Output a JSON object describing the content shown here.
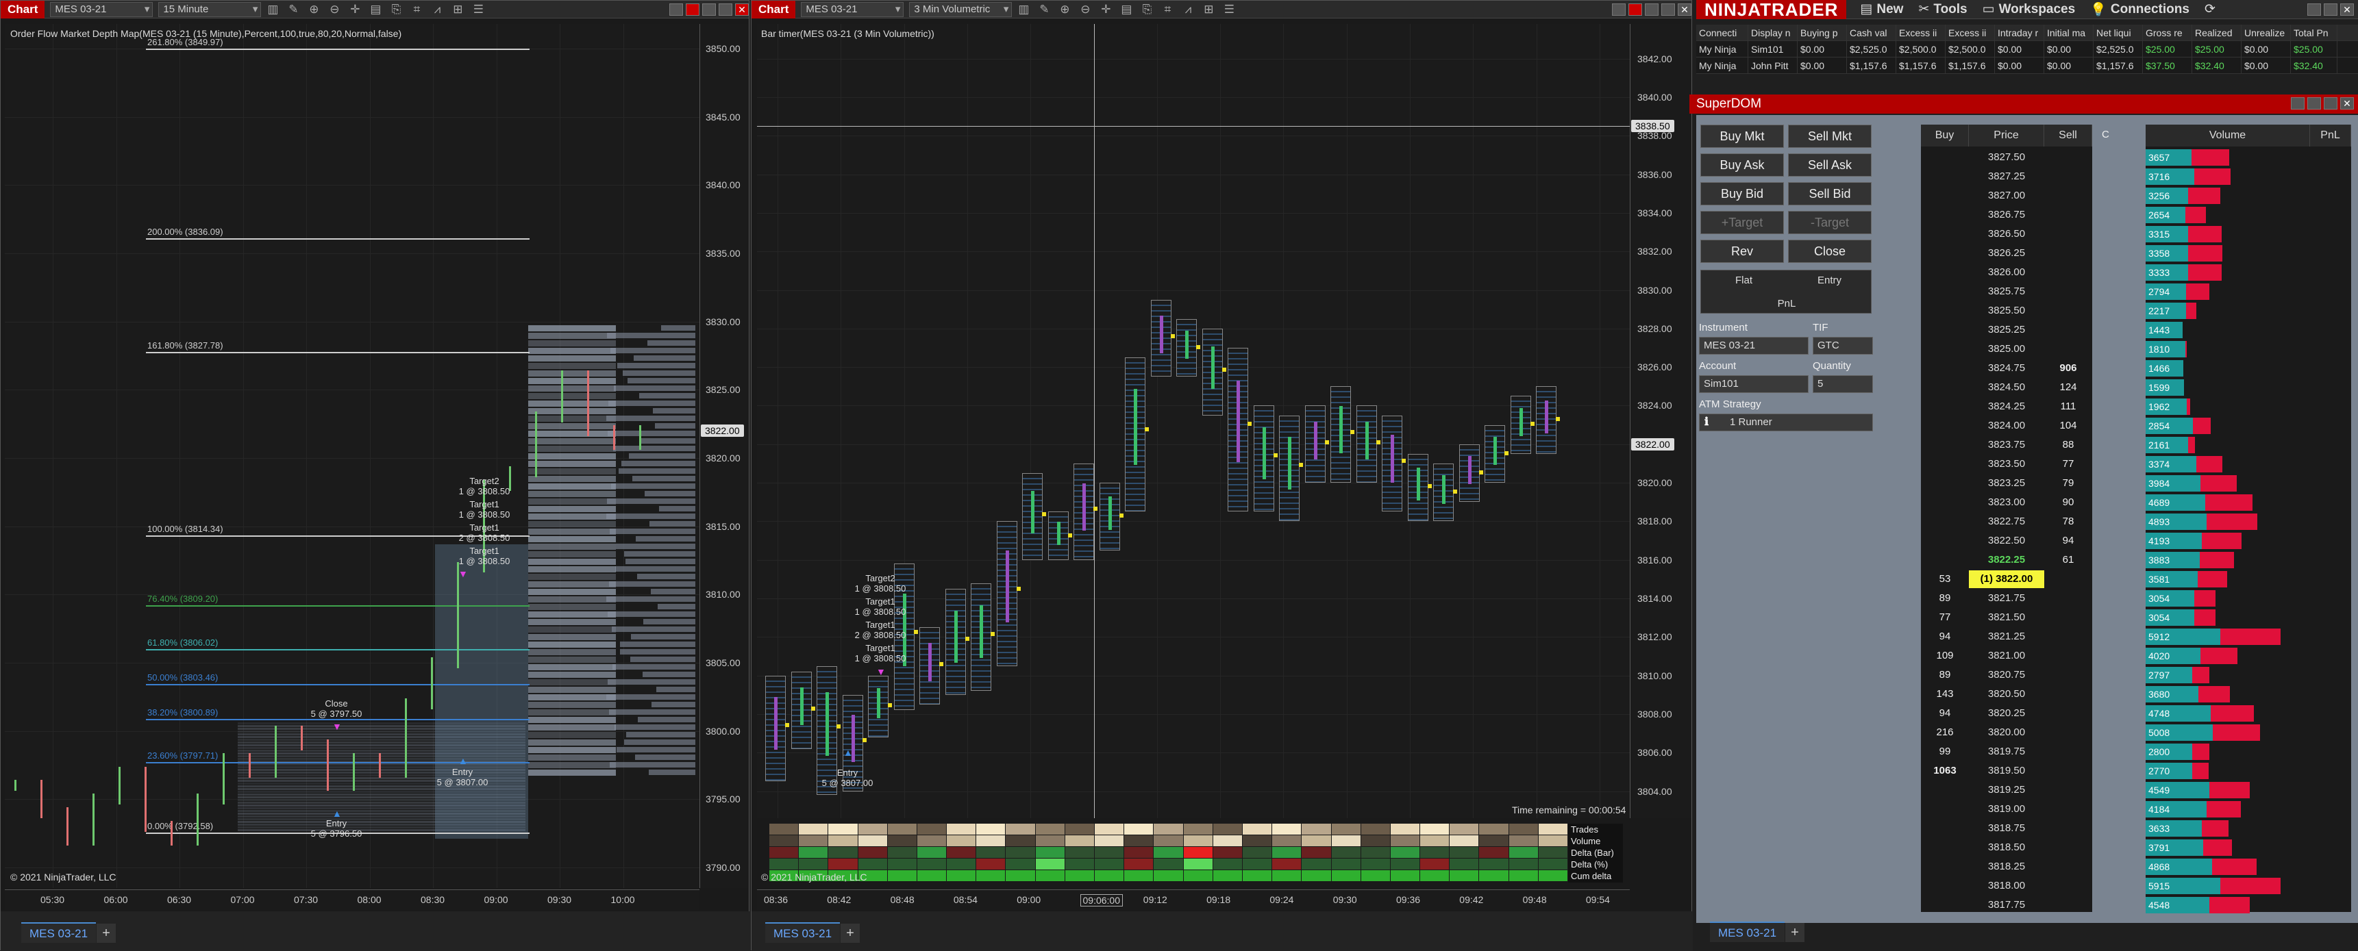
{
  "left_chart": {
    "tab": "Chart",
    "instrument": "MES 03-21",
    "interval": "15 Minute",
    "indicator_label": "Order Flow Market Depth Map(MES 03-21 (15 Minute),Percent,100,true,80,20,Normal,false)",
    "copyright": "© 2021 NinjaTrader, LLC",
    "price_badge": "3822.00",
    "fib_levels": [
      {
        "label": "261.80% (3849.97)",
        "price": 3849.97,
        "color": "#cfcfcf"
      },
      {
        "label": "200.00% (3836.09)",
        "price": 3836.09,
        "color": "#cfcfcf"
      },
      {
        "label": "161.80% (3827.78)",
        "price": 3827.78,
        "color": "#cfcfcf"
      },
      {
        "label": "100.00% (3814.34)",
        "price": 3814.34,
        "color": "#cfcfcf"
      },
      {
        "label": "76.40% (3809.20)",
        "price": 3809.2,
        "color": "#3fa34d"
      },
      {
        "label": "61.80% (3806.02)",
        "price": 3806.02,
        "color": "#3fb0b0"
      },
      {
        "label": "50.00% (3803.46)",
        "price": 3803.46,
        "color": "#3b7fd0"
      },
      {
        "label": "38.20% (3800.89)",
        "price": 3800.89,
        "color": "#3b7fd0"
      },
      {
        "label": "23.60% (3797.71)",
        "price": 3797.71,
        "color": "#3b7fd0"
      },
      {
        "label": "0.00% (3792.58)",
        "price": 3792.58,
        "color": "#cfcfcf"
      }
    ],
    "y_ticks": [
      "3850.00",
      "3845.00",
      "3840.00",
      "3835.00",
      "3830.00",
      "3825.00",
      "3820.00",
      "3815.00",
      "3810.00",
      "3805.00",
      "3800.00",
      "3795.00",
      "3790.00"
    ],
    "x_ticks": [
      "05:30",
      "06:00",
      "06:30",
      "07:00",
      "07:30",
      "08:00",
      "08:30",
      "09:00",
      "09:30",
      "10:00"
    ],
    "annotations": {
      "target2": "Target2",
      "target2_qty": "1 @ 3808.50",
      "target1a": "Target1",
      "target1a_qty": "1 @ 3808.50",
      "target1b": "Target1",
      "target1b_qty": "2 @ 3808.50",
      "target1c": "Target1",
      "target1c_qty": "1 @ 3808.50",
      "close": "Close",
      "close_qty": "5 @ 3797.50",
      "entry1": "Entry",
      "entry1_qty": "5 @ 3807.00",
      "entry2": "Entry",
      "entry2_qty": "5 @ 3796.50"
    },
    "bottom_tab": "MES 03-21"
  },
  "right_chart": {
    "tab": "Chart",
    "instrument": "MES 03-21",
    "interval": "3 Min Volumetric",
    "indicator_label": "Bar timer(MES 03-21 (3 Min Volumetric))",
    "copyright": "© 2021 NinjaTrader, LLC",
    "crosshair_price": "3838.50",
    "price_badge": "3822.00",
    "time_remaining": "Time remaining = 00:00:54",
    "y_ticks": [
      "3842.00",
      "3840.00",
      "3838.00",
      "3836.00",
      "3834.00",
      "3832.00",
      "3830.00",
      "3828.00",
      "3826.00",
      "3824.00",
      "3822.00",
      "3820.00",
      "3818.00",
      "3816.00",
      "3814.00",
      "3812.00",
      "3810.00",
      "3808.00",
      "3806.00",
      "3804.00"
    ],
    "x_ticks": [
      "08:36",
      "08:42",
      "08:48",
      "08:54",
      "09:00",
      "09:06:00",
      "09:12",
      "09:18",
      "09:24",
      "09:30",
      "09:36",
      "09:42",
      "09:48",
      "09:54"
    ],
    "stats_labels": [
      "Trades",
      "Volume",
      "Delta (Bar)",
      "Delta (%)",
      "Cum delta"
    ],
    "annotations": {
      "target2": "Target2",
      "target2_qty": "1 @ 3808.50",
      "target1a": "Target1",
      "target1a_qty": "1 @ 3808.50",
      "target1b": "Target1",
      "target1b_qty": "2 @ 3808.50",
      "target1c": "Target1",
      "target1c_qty": "1 @ 3808.50",
      "entry": "Entry",
      "entry_qty": "5 @ 3807.00"
    },
    "bottom_tab": "MES 03-21"
  },
  "menubar": {
    "logo": "NINJATRADER",
    "items": [
      "New",
      "Tools",
      "Workspaces",
      "Connections"
    ]
  },
  "accounts": {
    "headers": [
      "Connecti",
      "Display n",
      "Buying p",
      "Cash val",
      "Excess ii",
      "Excess ii",
      "Intraday r",
      "Initial ma",
      "Net liqui",
      "Gross re",
      "Realized",
      "Unrealize",
      "Total Pn"
    ],
    "rows": [
      [
        "My Ninja",
        "Sim101",
        "$0.00",
        "$2,525.0",
        "$2,500.0",
        "$2,500.0",
        "$0.00",
        "$0.00",
        "$2,525.0",
        "$25.00",
        "$25.00",
        "$0.00",
        "$25.00"
      ],
      [
        "My Ninja",
        "John Pitt",
        "$0.00",
        "$1,157.6",
        "$1,157.6",
        "$1,157.6",
        "$0.00",
        "$0.00",
        "$1,157.6",
        "$37.50",
        "$32.40",
        "$0.00",
        "$32.40"
      ]
    ]
  },
  "superdom": {
    "title": "SuperDOM",
    "buttons": {
      "buy_mkt": "Buy Mkt",
      "sell_mkt": "Sell Mkt",
      "buy_ask": "Buy Ask",
      "sell_ask": "Sell Ask",
      "buy_bid": "Buy Bid",
      "sell_bid": "Sell Bid",
      "plus_target": "+Target",
      "minus_target": "-Target",
      "rev": "Rev",
      "close": "Close",
      "flat": "Flat",
      "entry": "Entry",
      "pnl": "PnL"
    },
    "instrument_label": "Instrument",
    "instrument": "MES 03-21",
    "tif_label": "TIF",
    "tif": "GTC",
    "account_label": "Account",
    "account": "Sim101",
    "quantity_label": "Quantity",
    "quantity": "5",
    "atm_label": "ATM Strategy",
    "atm": "1 Runner",
    "col_headers": {
      "buy": "Buy",
      "price": "Price",
      "sell": "Sell",
      "c": "C",
      "volume": "Volume",
      "pnl": "PnL"
    },
    "rows": [
      {
        "price": "3827.50",
        "buy": "",
        "sell": "",
        "vol": "3657",
        "v": 3657,
        "g": 0.22
      },
      {
        "price": "3827.25",
        "buy": "",
        "sell": "",
        "vol": "3716",
        "v": 3716,
        "g": 0.25
      },
      {
        "price": "3827.00",
        "buy": "",
        "sell": "",
        "vol": "3256",
        "v": 3256,
        "g": 0.2
      },
      {
        "price": "3826.75",
        "buy": "",
        "sell": "",
        "vol": "2654",
        "v": 2654,
        "g": 0.2
      },
      {
        "price": "3826.50",
        "buy": "",
        "sell": "",
        "vol": "3315",
        "v": 3315,
        "g": 0.2
      },
      {
        "price": "3826.25",
        "buy": "",
        "sell": "",
        "vol": "3358",
        "v": 3358,
        "g": 0.2
      },
      {
        "price": "3826.00",
        "buy": "",
        "sell": "",
        "vol": "3333",
        "v": 3333,
        "g": 0.2
      },
      {
        "price": "3825.75",
        "buy": "",
        "sell": "",
        "vol": "2794",
        "v": 2794,
        "g": 0.2
      },
      {
        "price": "3825.50",
        "buy": "",
        "sell": "",
        "vol": "2217",
        "v": 2217,
        "g": 0.25
      },
      {
        "price": "3825.25",
        "buy": "",
        "sell": "",
        "vol": "1443",
        "v": 1443,
        "g": 0.3
      },
      {
        "price": "3825.00",
        "buy": "",
        "sell": "",
        "vol": "1810",
        "v": 1810,
        "g": 0.3
      },
      {
        "price": "3824.75",
        "buy": "",
        "sell": "906",
        "vol": "1466",
        "v": 1466,
        "g": 0.3
      },
      {
        "price": "3824.50",
        "buy": "",
        "sell": "124",
        "vol": "1599",
        "v": 1599,
        "g": 0.3
      },
      {
        "price": "3824.25",
        "buy": "",
        "sell": "111",
        "vol": "1962",
        "v": 1962,
        "g": 0.3
      },
      {
        "price": "3824.00",
        "buy": "",
        "sell": "104",
        "vol": "2854",
        "v": 2854,
        "g": 0.3
      },
      {
        "price": "3823.75",
        "buy": "",
        "sell": "88",
        "vol": "2161",
        "v": 2161,
        "g": 0.3
      },
      {
        "price": "3823.50",
        "buy": "",
        "sell": "77",
        "vol": "3374",
        "v": 3374,
        "g": 0.3
      },
      {
        "price": "3823.25",
        "buy": "",
        "sell": "79",
        "vol": "3984",
        "v": 3984,
        "g": 0.3
      },
      {
        "price": "3823.00",
        "buy": "",
        "sell": "90",
        "vol": "4689",
        "v": 4689,
        "g": 0.3
      },
      {
        "price": "3822.75",
        "buy": "",
        "sell": "78",
        "vol": "4893",
        "v": 4893,
        "g": 0.3
      },
      {
        "price": "3822.50",
        "buy": "",
        "sell": "94",
        "vol": "4193",
        "v": 4193,
        "g": 0.3
      },
      {
        "price": "3822.25",
        "buy": "",
        "sell": "61",
        "vol": "3883",
        "v": 3883,
        "g": 0.3,
        "last": true
      },
      {
        "price": "(1) 3822.00",
        "buy": "53",
        "sell": "",
        "vol": "3581",
        "v": 3581,
        "g": 0.3,
        "current": true
      },
      {
        "price": "3821.75",
        "buy": "89",
        "sell": "",
        "vol": "3054",
        "v": 3054,
        "g": 0.3
      },
      {
        "price": "3821.50",
        "buy": "77",
        "sell": "",
        "vol": "3054",
        "v": 3054,
        "g": 0.3
      },
      {
        "price": "3821.25",
        "buy": "94",
        "sell": "",
        "vol": "5912",
        "v": 5912,
        "g": 0.35
      },
      {
        "price": "3821.00",
        "buy": "109",
        "sell": "",
        "vol": "4020",
        "v": 4020,
        "g": 0.3
      },
      {
        "price": "3820.75",
        "buy": "89",
        "sell": "",
        "vol": "2797",
        "v": 2797,
        "g": 0.3
      },
      {
        "price": "3820.50",
        "buy": "143",
        "sell": "",
        "vol": "3680",
        "v": 3680,
        "g": 0.3
      },
      {
        "price": "3820.25",
        "buy": "94",
        "sell": "",
        "vol": "4748",
        "v": 4748,
        "g": 0.35
      },
      {
        "price": "3820.00",
        "buy": "216",
        "sell": "",
        "vol": "5008",
        "v": 5008,
        "g": 0.35
      },
      {
        "price": "3819.75",
        "buy": "99",
        "sell": "",
        "vol": "2800",
        "v": 2800,
        "g": 0.3
      },
      {
        "price": "3819.50",
        "buy": "1063",
        "sell": "",
        "vol": "2770",
        "v": 2770,
        "g": 0.3
      },
      {
        "price": "3819.25",
        "buy": "",
        "sell": "",
        "vol": "4549",
        "v": 4549,
        "g": 0.35
      },
      {
        "price": "3819.00",
        "buy": "",
        "sell": "",
        "vol": "4184",
        "v": 4184,
        "g": 0.35
      },
      {
        "price": "3818.75",
        "buy": "",
        "sell": "",
        "vol": "3633",
        "v": 3633,
        "g": 0.35
      },
      {
        "price": "3818.50",
        "buy": "",
        "sell": "",
        "vol": "3791",
        "v": 3791,
        "g": 0.35
      },
      {
        "price": "3818.25",
        "buy": "",
        "sell": "",
        "vol": "4868",
        "v": 4868,
        "g": 0.35
      },
      {
        "price": "3818.00",
        "buy": "",
        "sell": "",
        "vol": "5915",
        "v": 5915,
        "g": 0.35
      },
      {
        "price": "3817.75",
        "buy": "",
        "sell": "",
        "vol": "4548",
        "v": 4548,
        "g": 0.35
      }
    ],
    "bottom_tab": "MES 03-21"
  }
}
